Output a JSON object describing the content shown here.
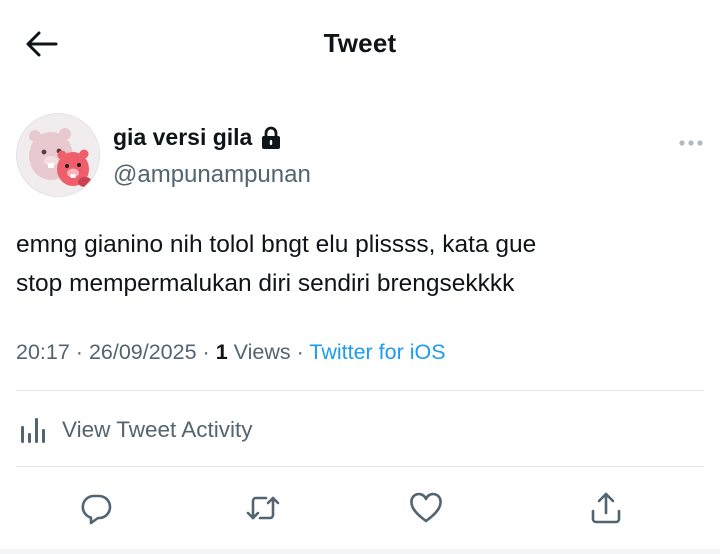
{
  "header": {
    "title": "Tweet"
  },
  "author": {
    "display_name": "gia versi gila",
    "handle": "@ampunampunan",
    "protected": true
  },
  "tweet": {
    "text": "emng gianino nih tolol bngt elu plissss, kata gue\nstop mempermalukan diri sendiri brengsekkkk",
    "time": "20:17",
    "date": "26/09/2025",
    "views_count": "1",
    "views_label": "Views",
    "source": "Twitter for iOS",
    "separator": "·"
  },
  "activity": {
    "label": "View Tweet Activity"
  },
  "actions": {
    "items": [
      "reply-icon",
      "retweet-icon",
      "like-icon",
      "share-icon"
    ]
  },
  "colors": {
    "text": "#0f1419",
    "secondary": "#536471",
    "link": "#1d9bf0",
    "divider": "#e1e6ea"
  }
}
